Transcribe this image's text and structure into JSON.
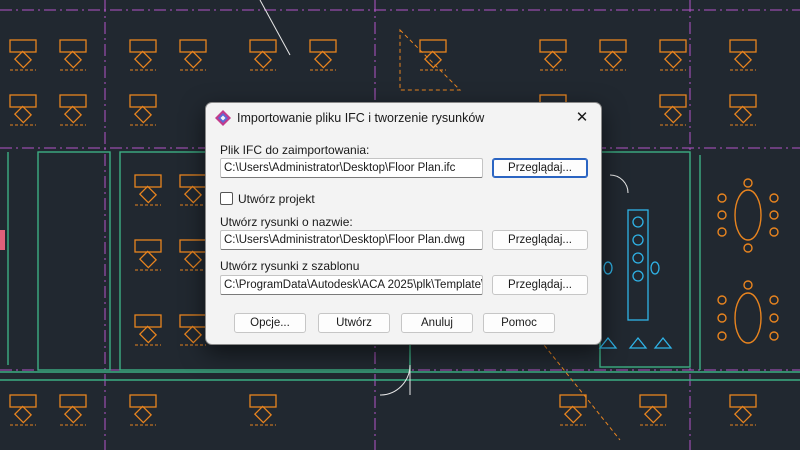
{
  "dialog": {
    "title": "Importowanie pliku IFC i tworzenie rysunków",
    "close_glyph": "✕",
    "ifc_label": "Plik IFC do zaimportowania:",
    "ifc_path": "C:\\Users\\Administrator\\Desktop\\Floor Plan.ifc",
    "browse_label": "Przeglądaj...",
    "create_project_label": "Utwórz projekt",
    "drawings_name_label": "Utwórz rysunki o nazwie:",
    "drawings_path": "C:\\Users\\Administrator\\Desktop\\Floor Plan.dwg",
    "template_label": "Utwórz rysunki z szablonu",
    "template_path": "C:\\ProgramData\\Autodesk\\ACA 2025\\plk\\Template\\AutoC",
    "options_label": "Opcje...",
    "create_label": "Utwórz",
    "cancel_label": "Anuluj",
    "help_label": "Pomoc"
  },
  "colors": {
    "background": "#212830",
    "furniture": "#e8841f",
    "walls": "#3cae83",
    "grid": "#b455c8",
    "fixtures": "#2fb4e8",
    "accent": "#2a64c2"
  }
}
